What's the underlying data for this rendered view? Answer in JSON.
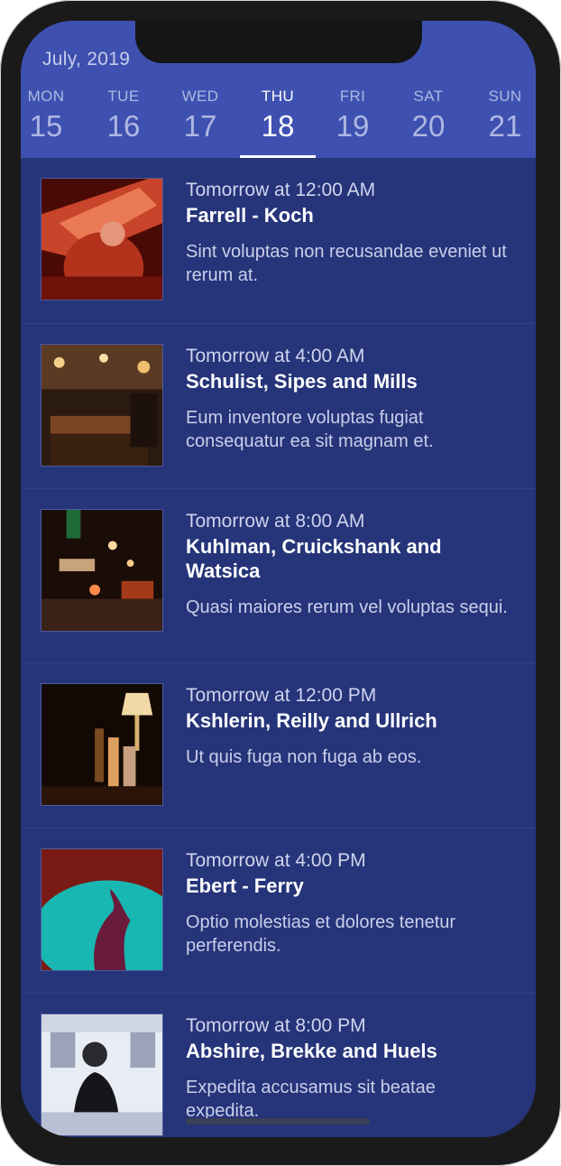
{
  "header": {
    "month_year": "July,  2019"
  },
  "week": [
    {
      "dow": "MON",
      "num": "15"
    },
    {
      "dow": "TUE",
      "num": "16"
    },
    {
      "dow": "WED",
      "num": "17"
    },
    {
      "dow": "THU",
      "num": "18"
    },
    {
      "dow": "FRI",
      "num": "19"
    },
    {
      "dow": "SAT",
      "num": "20"
    },
    {
      "dow": "SUN",
      "num": "21"
    }
  ],
  "events": [
    {
      "time": "Tomorrow at 12:00 AM",
      "title": "Farrell - Koch",
      "description": "Sint voluptas non recusandae eveniet ut rerum at.",
      "image_icon": "party-photo-icon"
    },
    {
      "time": "Tomorrow at 4:00 AM",
      "title": "Schulist, Sipes and Mills",
      "description": "Eum inventore voluptas fugiat consequatur ea sit magnam et.",
      "image_icon": "bar-interior-photo-icon"
    },
    {
      "time": "Tomorrow at 8:00 AM",
      "title": "Kuhlman, Cruickshank and Watsica",
      "description": "Quasi maiores rerum vel voluptas sequi.",
      "image_icon": "street-night-photo-icon"
    },
    {
      "time": "Tomorrow at 12:00 PM",
      "title": "Kshlerin, Reilly and Ullrich",
      "description": "Ut quis fuga non fuga ab eos.",
      "image_icon": "bar-bottles-photo-icon"
    },
    {
      "time": "Tomorrow at 4:00 PM",
      "title": "Ebert - Ferry",
      "description": "Optio molestias et dolores tenetur perferendis.",
      "image_icon": "dancer-photo-icon"
    },
    {
      "time": "Tomorrow at 8:00 PM",
      "title": "Abshire, Brekke and Huels",
      "description": "Expedita accusamus sit beatae expedita.",
      "image_icon": "bartender-photo-icon"
    }
  ],
  "colors": {
    "header_bg": "#3e51b0",
    "list_bg": "#263479",
    "active_day": "#ffffff",
    "inactive_day": "#aeb7e2"
  }
}
